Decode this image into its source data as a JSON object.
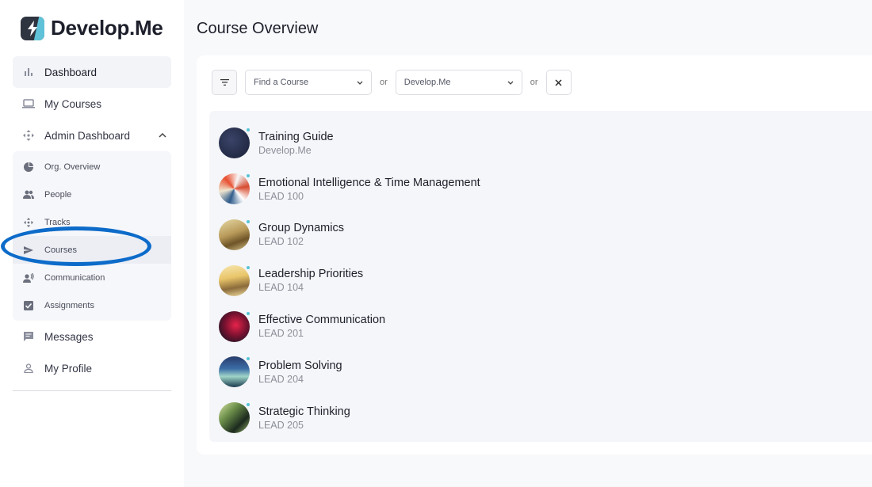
{
  "brand": {
    "name": "Develop.Me"
  },
  "sidebar": {
    "items": [
      {
        "label": "Dashboard",
        "icon": "bar-chart-icon"
      },
      {
        "label": "My Courses",
        "icon": "laptop-icon"
      },
      {
        "label": "Admin Dashboard",
        "icon": "move-icon"
      }
    ],
    "admin_items": [
      {
        "label": "Org. Overview",
        "icon": "pie-chart-icon"
      },
      {
        "label": "People",
        "icon": "people-icon"
      },
      {
        "label": "Tracks",
        "icon": "move-icon"
      },
      {
        "label": "Courses",
        "icon": "send-icon"
      },
      {
        "label": "Communication",
        "icon": "record-voice-icon"
      },
      {
        "label": "Assignments",
        "icon": "checkbox-icon"
      }
    ],
    "bottom_items": [
      {
        "label": "Messages",
        "icon": "message-icon"
      },
      {
        "label": "My Profile",
        "icon": "person-icon"
      }
    ]
  },
  "main": {
    "title": "Course Overview",
    "filters": {
      "course_select": "Find a Course",
      "or_1": "or",
      "org_select": "Develop.Me",
      "or_2": "or"
    },
    "courses": [
      {
        "title": "Training Guide",
        "code": "Develop.Me"
      },
      {
        "title": "Emotional Intelligence & Time Management",
        "code": "LEAD 100"
      },
      {
        "title": "Group Dynamics",
        "code": "LEAD 102"
      },
      {
        "title": "Leadership Priorities",
        "code": "LEAD 104"
      },
      {
        "title": "Effective Communication",
        "code": "LEAD 201"
      },
      {
        "title": "Problem Solving",
        "code": "LEAD 204"
      },
      {
        "title": "Strategic Thinking",
        "code": "LEAD 205"
      }
    ]
  },
  "colors": {
    "accent": "#57c4d6",
    "highlight": "#0d6bc9"
  }
}
